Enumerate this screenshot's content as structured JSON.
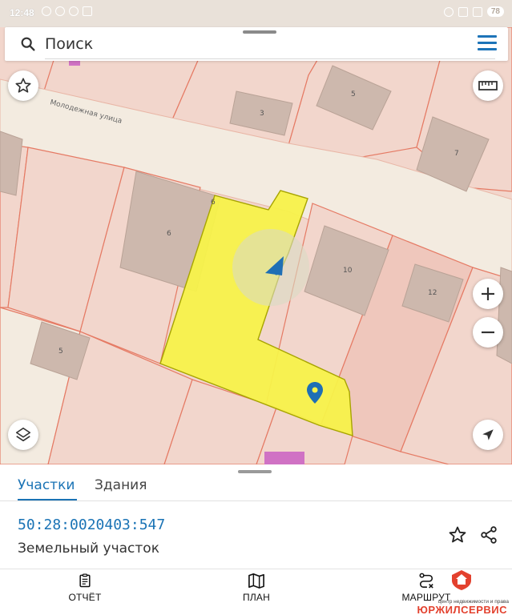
{
  "status_bar": {
    "time": "12:48",
    "battery": "78"
  },
  "search": {
    "placeholder": "Поиск"
  },
  "map": {
    "street_name": "Молодежная улица",
    "building_labels": [
      "3",
      "5",
      "7",
      "6",
      "10",
      "12",
      "5"
    ],
    "house_number_label": "6",
    "colors": {
      "parcel_fill": "#f2d6cc",
      "parcel_border": "#e57a64",
      "building_fill": "#cdb8ad",
      "road_fill": "#f3ebe0",
      "selected_fill": "#f7f24a",
      "selected_border": "#a7a400",
      "location_marker": "#1f6fb5"
    }
  },
  "map_controls": {
    "favorite": "star-icon",
    "ruler": "ruler-icon",
    "zoom_in": "+",
    "zoom_out": "−",
    "layers": "layers-icon",
    "my_location": "navigation-arrow-icon"
  },
  "sheet": {
    "tabs": [
      {
        "label": "Участки",
        "active": true
      },
      {
        "label": "Здания",
        "active": false
      }
    ],
    "cadastral_number": "50:28:0020403:547",
    "object_type": "Земельный участок",
    "accent_color": "#1a73b5"
  },
  "bottom_nav": [
    {
      "label": "ОТЧЁТ",
      "icon": "report-icon"
    },
    {
      "label": "ПЛАН",
      "icon": "map-plan-icon"
    },
    {
      "label": "МАРШРУТ",
      "icon": "route-icon"
    }
  ],
  "watermark": {
    "subtitle": "центр недвижимости и права",
    "brand": "ЮРЖИЛСЕРВИС"
  }
}
